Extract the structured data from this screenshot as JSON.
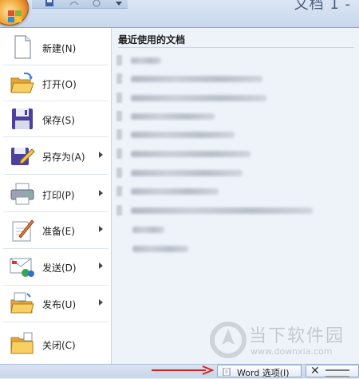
{
  "window": {
    "title": "文档 1 -"
  },
  "menu": {
    "items": [
      {
        "label": "新建(N)",
        "icon": "new-document-icon",
        "has_submenu": false
      },
      {
        "label": "打开(O)",
        "icon": "open-folder-icon",
        "has_submenu": false
      },
      {
        "label": "保存(S)",
        "icon": "save-disk-icon",
        "has_submenu": false
      },
      {
        "label": "另存为(A)",
        "icon": "save-as-icon",
        "has_submenu": true
      },
      {
        "label": "打印(P)",
        "icon": "printer-icon",
        "has_submenu": true
      },
      {
        "label": "准备(E)",
        "icon": "prepare-icon",
        "has_submenu": true
      },
      {
        "label": "发送(D)",
        "icon": "send-icon",
        "has_submenu": true
      },
      {
        "label": "发布(U)",
        "icon": "publish-icon",
        "has_submenu": true
      },
      {
        "label": "关闭(C)",
        "icon": "close-folder-icon",
        "has_submenu": false
      }
    ]
  },
  "recent": {
    "title": "最近使用的文档"
  },
  "bottom": {
    "word_options_label": "Word 选项(I)"
  },
  "watermark": {
    "title": "当下软件园",
    "url": "www.downxia.com"
  },
  "colors": {
    "accent_red": "#d9231e",
    "menu_border": "#8fa9cf",
    "office_orange": "#f2a93a"
  }
}
